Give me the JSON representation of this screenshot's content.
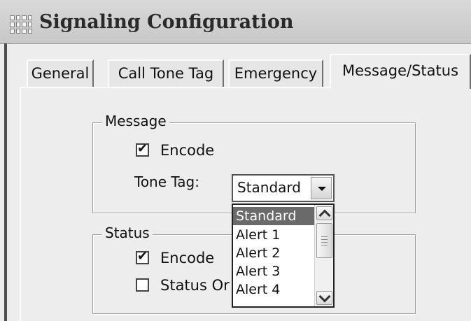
{
  "window": {
    "title": "Signaling Configuration",
    "icon": "grid-app-icon"
  },
  "tabs": [
    {
      "label": "General",
      "active": false
    },
    {
      "label": "Call Tone Tag",
      "active": false
    },
    {
      "label": "Emergency",
      "active": false
    },
    {
      "label": "Message/Status",
      "active": true
    }
  ],
  "message_group": {
    "title": "Message",
    "encode": {
      "label": "Encode",
      "checked": true
    },
    "tone_tag": {
      "label": "Tone Tag:",
      "value": "Standard",
      "options": [
        "Standard",
        "Alert 1",
        "Alert 2",
        "Alert 3",
        "Alert 4"
      ],
      "selected_index": 0
    }
  },
  "status_group": {
    "title": "Status",
    "encode": {
      "label": "Encode",
      "checked": true
    },
    "status_only": {
      "label": "Status Or",
      "checked": false
    }
  },
  "colors": {
    "selection": "#6a6a6a",
    "dialog_bg": "#ededed",
    "title_bar": "#cfcfcf"
  }
}
